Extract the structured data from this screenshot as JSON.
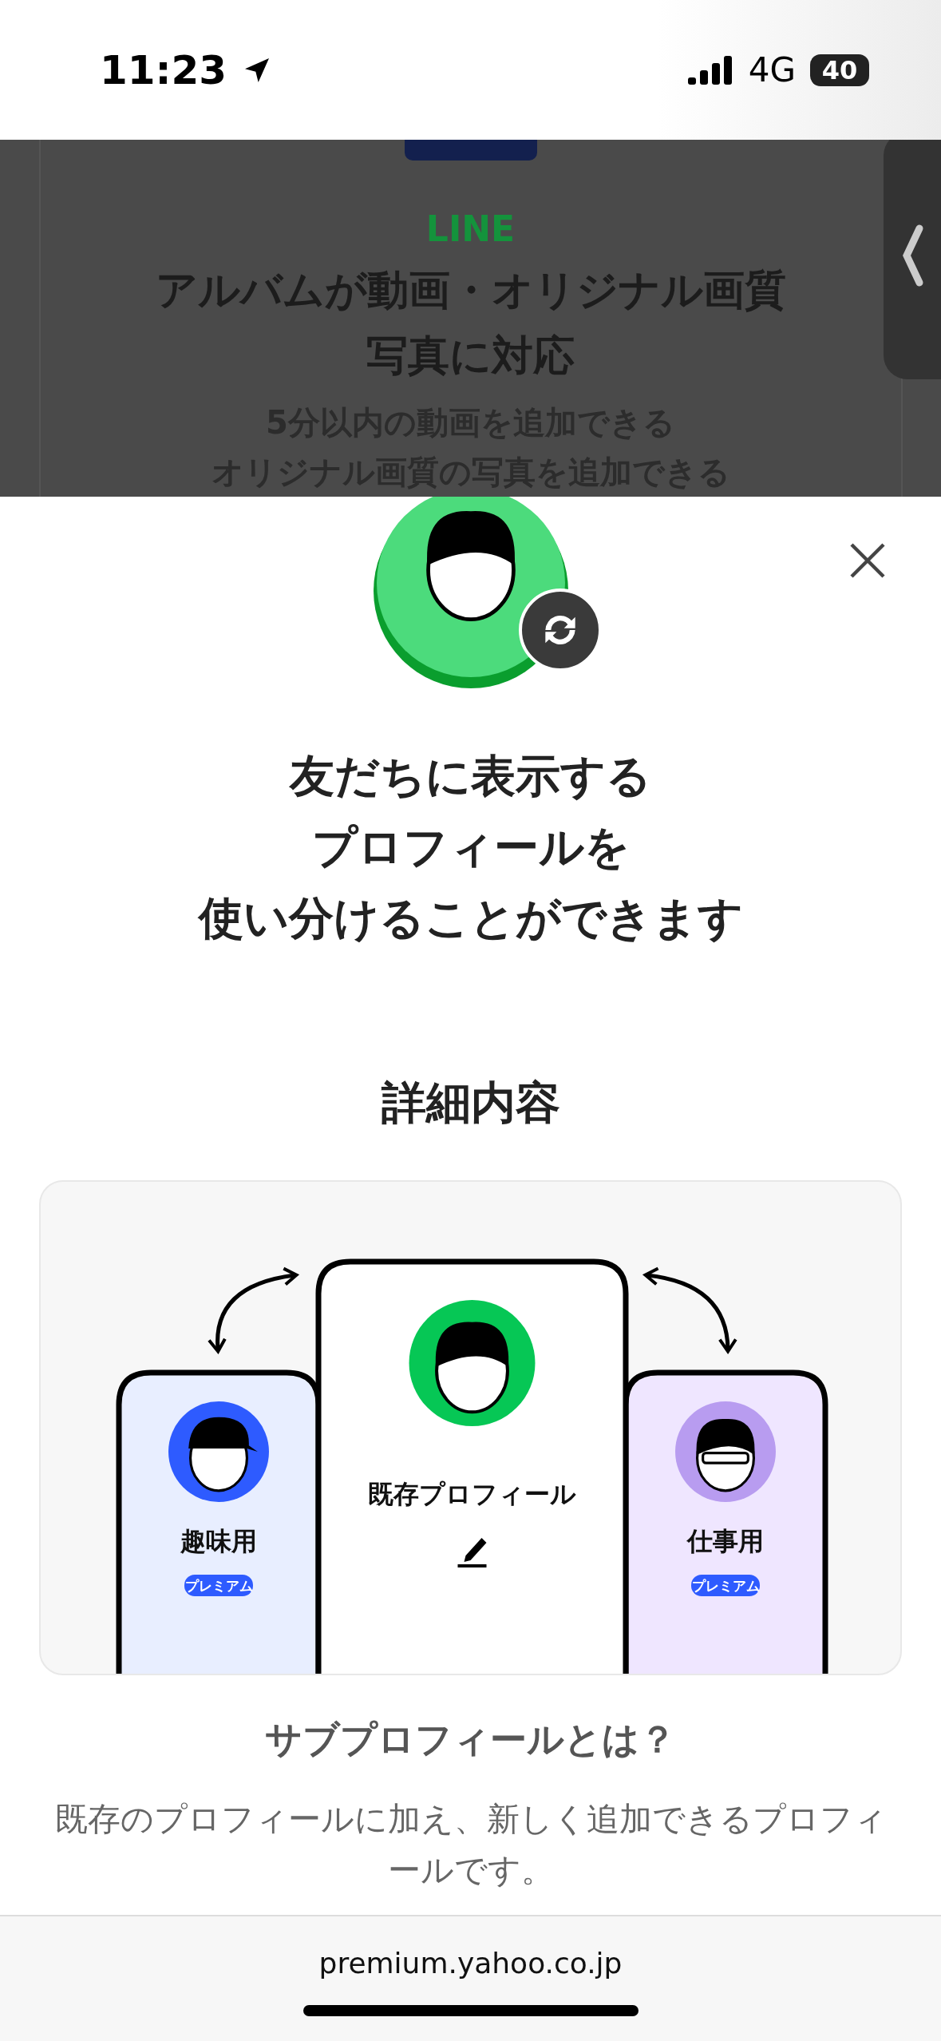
{
  "status_bar": {
    "time": "11:23",
    "network": "4G",
    "battery": "40"
  },
  "background_page": {
    "brand": "LINE",
    "title_lines": [
      "アルバムが動画・オリジナル画質",
      "写真に対応"
    ],
    "description_lines": [
      "5分以内の動画を追加できる",
      "オリジナル画質の写真を追加できる"
    ]
  },
  "sheet": {
    "heading_lines": [
      "友だちに表示する",
      "プロフィールを",
      "使い分けることができます"
    ],
    "section_title": "詳細内容",
    "illustration": {
      "profiles": [
        {
          "kind": "side",
          "label": "趣味用",
          "badge": "プレミアム",
          "color": "#2e5bff"
        },
        {
          "kind": "main",
          "label": "既存プロフィール",
          "color": "#06c755"
        },
        {
          "kind": "side",
          "label": "仕事用",
          "badge": "プレミアム",
          "color": "#b89cf0"
        }
      ]
    },
    "subheading": "サブプロフィールとは？",
    "paragraph": "既存のプロフィールに加え、新しく追加できるプロフィールです。"
  },
  "browser_bar": {
    "url": "premium.yahoo.co.jp"
  }
}
